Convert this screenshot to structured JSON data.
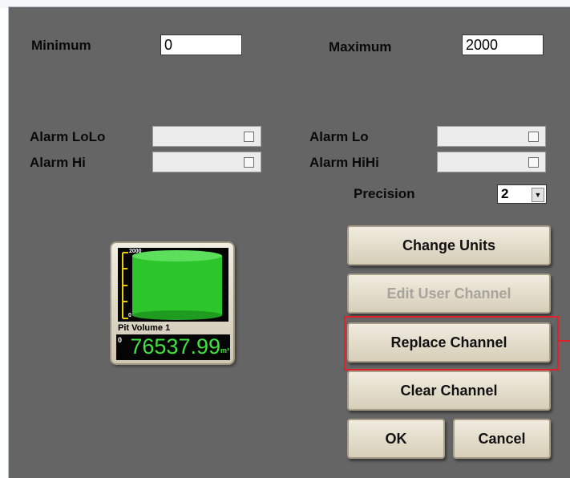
{
  "range": {
    "minimum_label": "Minimum",
    "minimum_value": "0",
    "maximum_label": "Maximum",
    "maximum_value": "2000"
  },
  "alarms": {
    "lolo_label": "Alarm LoLo",
    "lo_label": "Alarm Lo",
    "hi_label": "Alarm Hi",
    "hihi_label": "Alarm HiHi"
  },
  "precision": {
    "label": "Precision",
    "value": "2"
  },
  "buttons": {
    "change_units": "Change Units",
    "edit_user_channel": "Edit User Channel",
    "replace_channel": "Replace Channel",
    "clear_channel": "Clear Channel",
    "ok": "OK",
    "cancel": "Cancel"
  },
  "gauge": {
    "scale_top": "2000",
    "scale_bottom": "0",
    "name": "Pit Volume 1",
    "readout_prefix": "0",
    "value": "76537.99",
    "unit": "m³",
    "level_fraction": 1.0,
    "fill_color": "#2cc62c"
  },
  "colors": {
    "dialog_bg": "#656565",
    "highlight": "#e0202a",
    "readout_green": "#3fe33f"
  }
}
